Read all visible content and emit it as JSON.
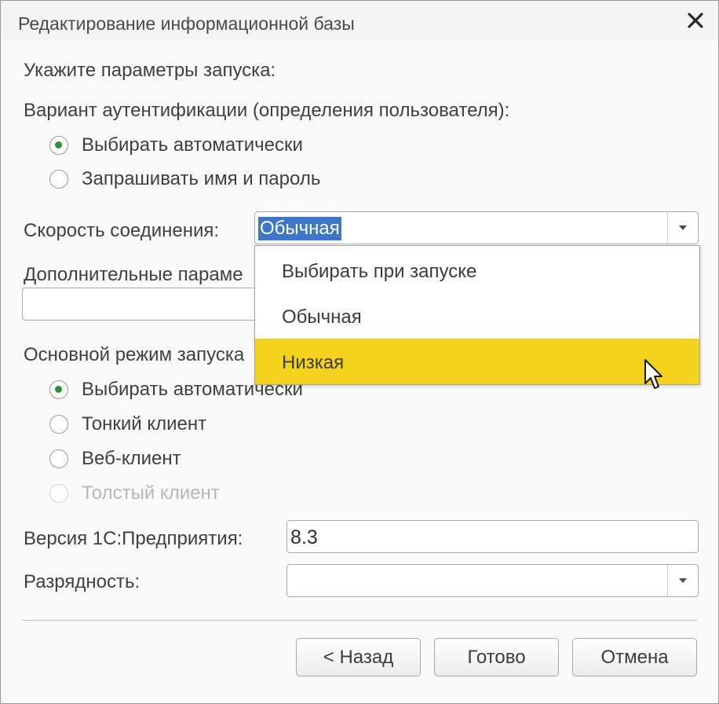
{
  "window": {
    "title": "Редактирование информационной базы"
  },
  "form": {
    "prompt": "Укажите параметры запуска:",
    "auth_group_label": "Вариант аутентификации (определения пользователя):",
    "auth_options": [
      {
        "label": "Выбирать автоматически",
        "checked": true
      },
      {
        "label": "Запрашивать имя и пароль",
        "checked": false
      }
    ],
    "speed_label": "Скорость соединения:",
    "speed_value": "Обычная",
    "extra_params_label": "Дополнительные параме",
    "extra_params_value": "",
    "mode_group_label": "Основной режим запуска",
    "mode_options": [
      {
        "label": "Выбирать автоматически",
        "checked": true,
        "disabled": false
      },
      {
        "label": "Тонкий клиент",
        "checked": false,
        "disabled": false
      },
      {
        "label": "Веб-клиент",
        "checked": false,
        "disabled": false
      },
      {
        "label": "Толстый клиент",
        "checked": false,
        "disabled": true
      }
    ],
    "version_label": "Версия 1С:Предприятия:",
    "version_value": "8.3",
    "bitness_label": "Разрядность:",
    "bitness_value": ""
  },
  "dropdown": {
    "options": [
      {
        "label": "Выбирать при запуске",
        "highlighted": false
      },
      {
        "label": "Обычная",
        "highlighted": false
      },
      {
        "label": "Низкая",
        "highlighted": true
      }
    ]
  },
  "buttons": {
    "back": "< Назад",
    "done": "Готово",
    "cancel": "Отмена"
  },
  "colors": {
    "highlight": "#f2d21a",
    "selection": "#3d78c8",
    "radio_check": "#2f8f3b"
  }
}
